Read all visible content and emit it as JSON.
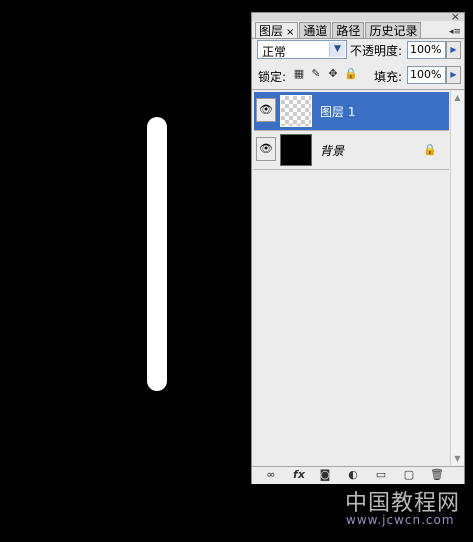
{
  "panel": {
    "tabs": [
      {
        "label": "图层",
        "close": "×",
        "active": true
      },
      {
        "label": "通道"
      },
      {
        "label": "路径"
      },
      {
        "label": "历史记录"
      }
    ],
    "close_glyph": "×",
    "menu_glyph": "◂≡",
    "blend_mode": "正常",
    "opacity_label": "不透明度:",
    "opacity_value": "100%",
    "lock_label": "锁定:",
    "fill_label": "填充:",
    "fill_value": "100%",
    "layers": [
      {
        "name": "图层 1",
        "selected": true,
        "thumb": "transparent"
      },
      {
        "name": "背景",
        "selected": false,
        "thumb": "black",
        "locked": true
      }
    ],
    "bottom_icons": [
      "link-icon",
      "fx-icon",
      "mask-icon",
      "adjustment-icon",
      "group-folder-icon",
      "new-layer-icon",
      "trash-icon"
    ],
    "fx_label": "fx"
  },
  "watermark": {
    "chinese": "中国教程网",
    "url": "www.jcwcn.com"
  }
}
